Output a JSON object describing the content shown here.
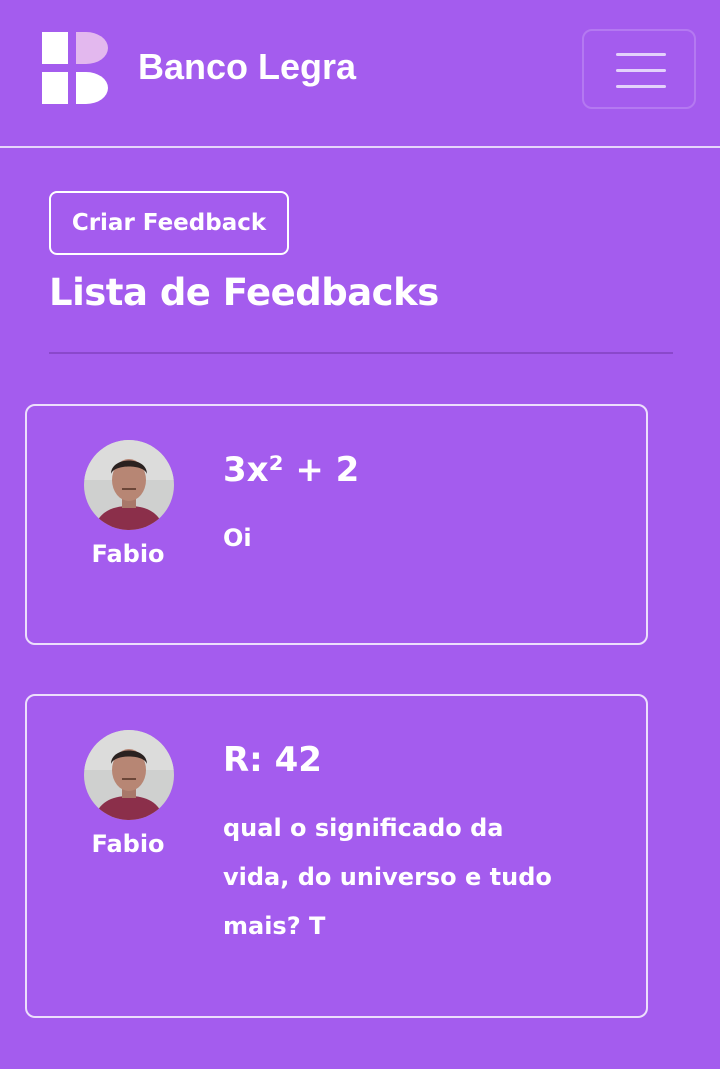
{
  "header": {
    "brand": "Banco Legra",
    "logo_icon": "banco-legra-logo",
    "menu_icon": "hamburger-menu-icon"
  },
  "actions": {
    "create_label": "Criar Feedback"
  },
  "page": {
    "title": "Lista de Feedbacks"
  },
  "feedbacks": [
    {
      "author": "Fabio",
      "avatar_icon": "user-avatar",
      "title": "3x² + 2",
      "body": "Oi"
    },
    {
      "author": "Fabio",
      "avatar_icon": "user-avatar",
      "title": "R: 42",
      "body": "qual o significado da vida, do universo e tudo mais? T"
    }
  ],
  "colors": {
    "background": "#a45cee",
    "text": "#ffffff",
    "logo_accent": "#e3b8ee",
    "divider": "#8a48cb"
  }
}
